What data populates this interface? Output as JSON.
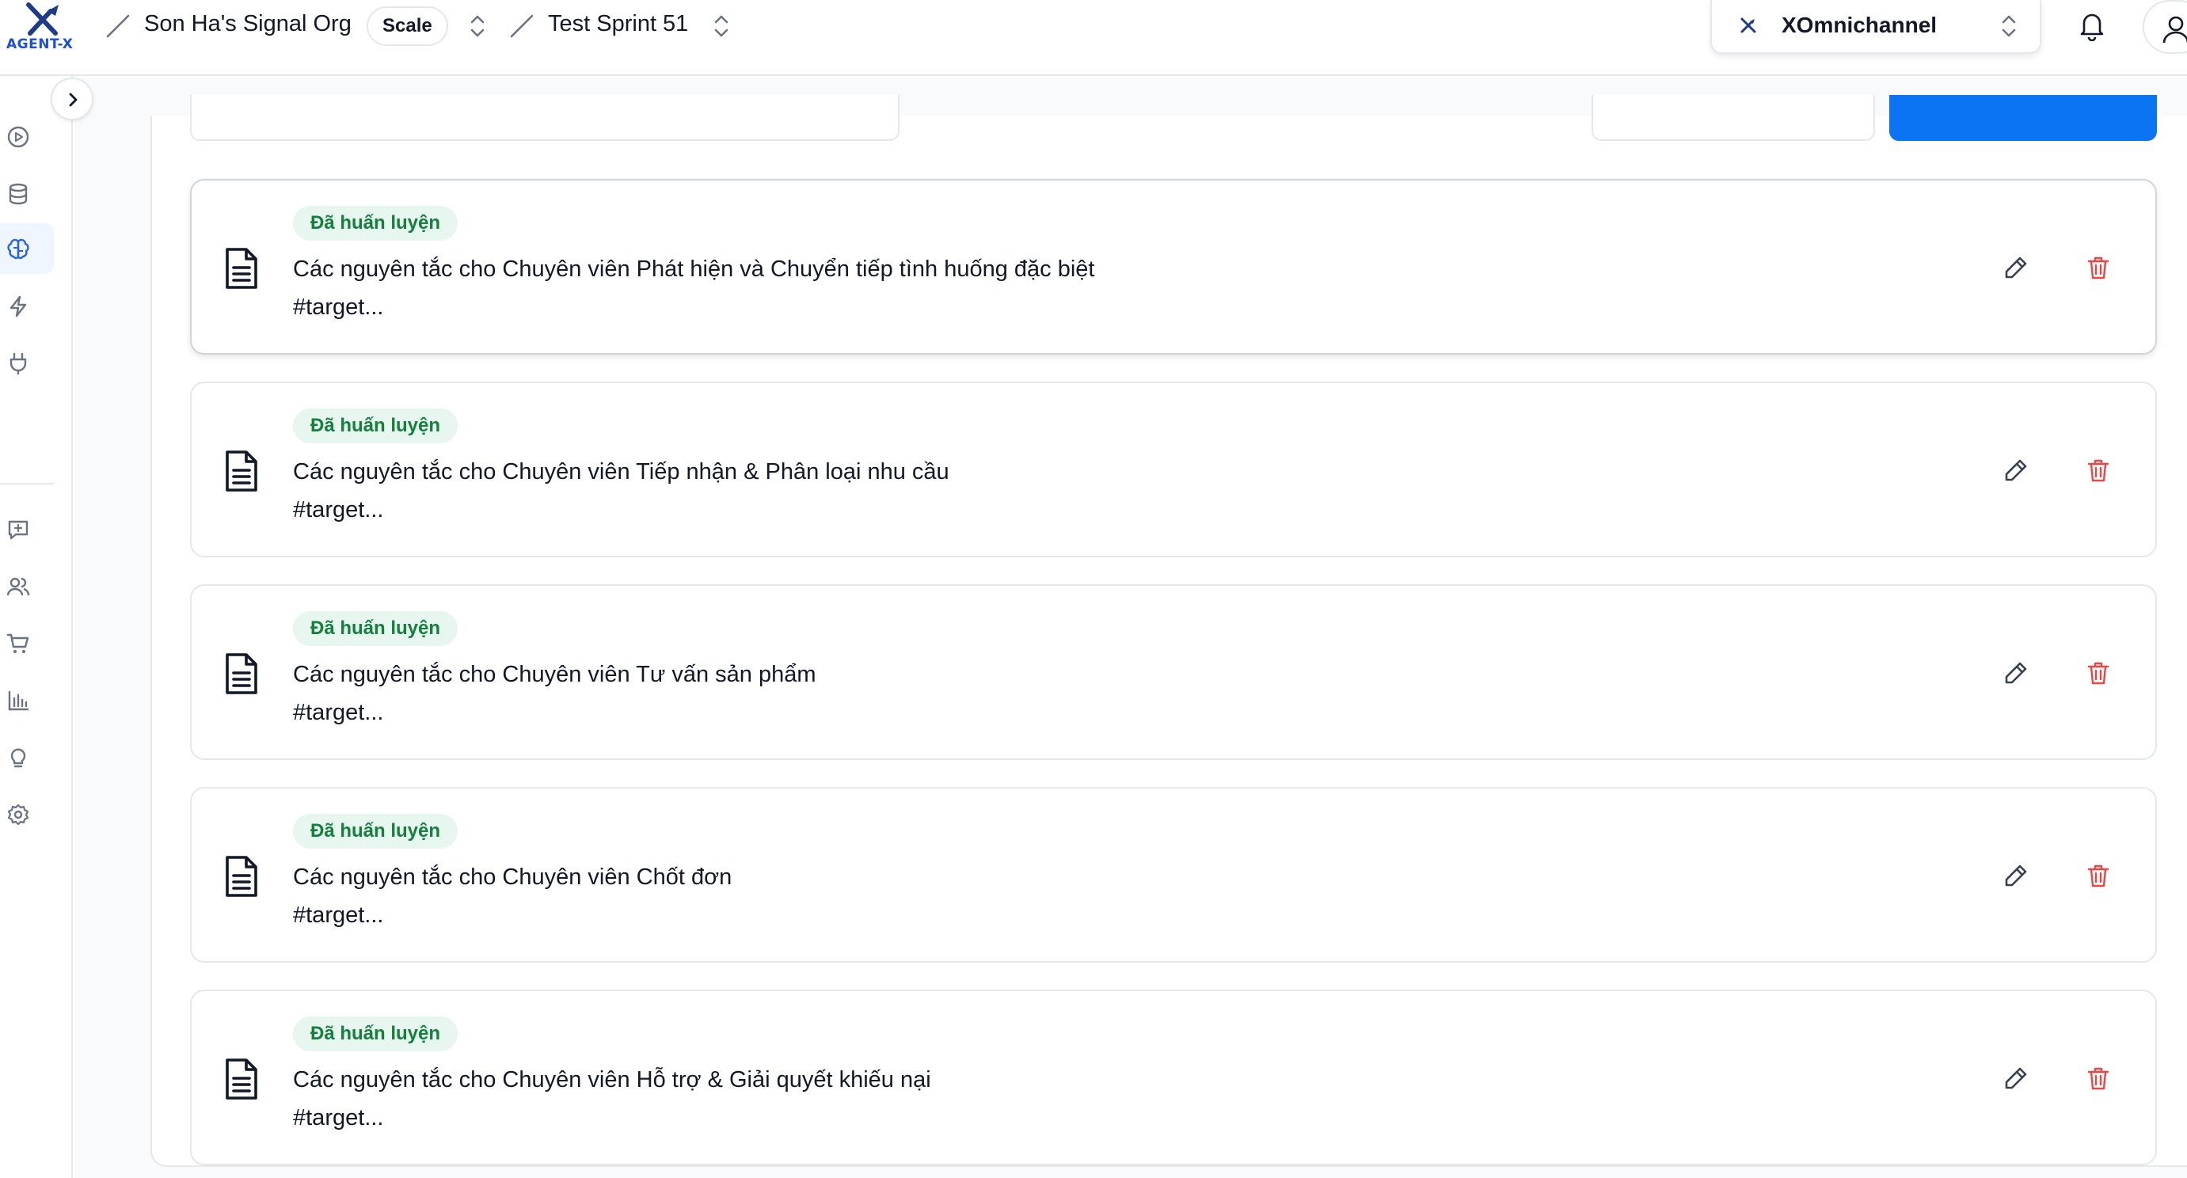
{
  "brand": {
    "name": "AGENT-X"
  },
  "breadcrumb": {
    "organization": "Son Ha's Signal Org",
    "plan": "Scale",
    "project": "Test Sprint 51"
  },
  "workspace": {
    "name": "XOmnichannel"
  },
  "icons": {
    "sidebar": [
      "play-circle-icon",
      "database-icon",
      "brain-icon",
      "zap-icon",
      "plug-icon",
      "message-plus-icon",
      "users-icon",
      "cart-icon",
      "bar-chart-icon",
      "lightbulb-icon",
      "settings-icon"
    ],
    "card_document": "file-text-icon",
    "card_edit": "pencil-icon",
    "card_delete": "trash-icon"
  },
  "colors": {
    "accent": "#0b74f2",
    "badge_bg": "#e7f6ee",
    "badge_text": "#15803d",
    "delete": "#ef4444"
  },
  "cards": [
    {
      "status": "Đã huấn luyện",
      "title": "Các nguyên tắc cho Chuyên viên Phát hiện và Chuyển tiếp tình huống đặc biệt",
      "tag": "#target..."
    },
    {
      "status": "Đã huấn luyện",
      "title": "Các nguyên tắc cho Chuyên viên Tiếp nhận & Phân loại nhu cầu",
      "tag": "#target..."
    },
    {
      "status": "Đã huấn luyện",
      "title": "Các nguyên tắc cho Chuyên viên Tư vấn sản phẩm",
      "tag": "#target..."
    },
    {
      "status": "Đã huấn luyện",
      "title": "Các nguyên tắc cho Chuyên viên Chốt đơn",
      "tag": "#target..."
    },
    {
      "status": "Đã huấn luyện",
      "title": "Các nguyên tắc cho Chuyên viên Hỗ trợ & Giải quyết khiếu nại",
      "tag": "#target..."
    }
  ]
}
